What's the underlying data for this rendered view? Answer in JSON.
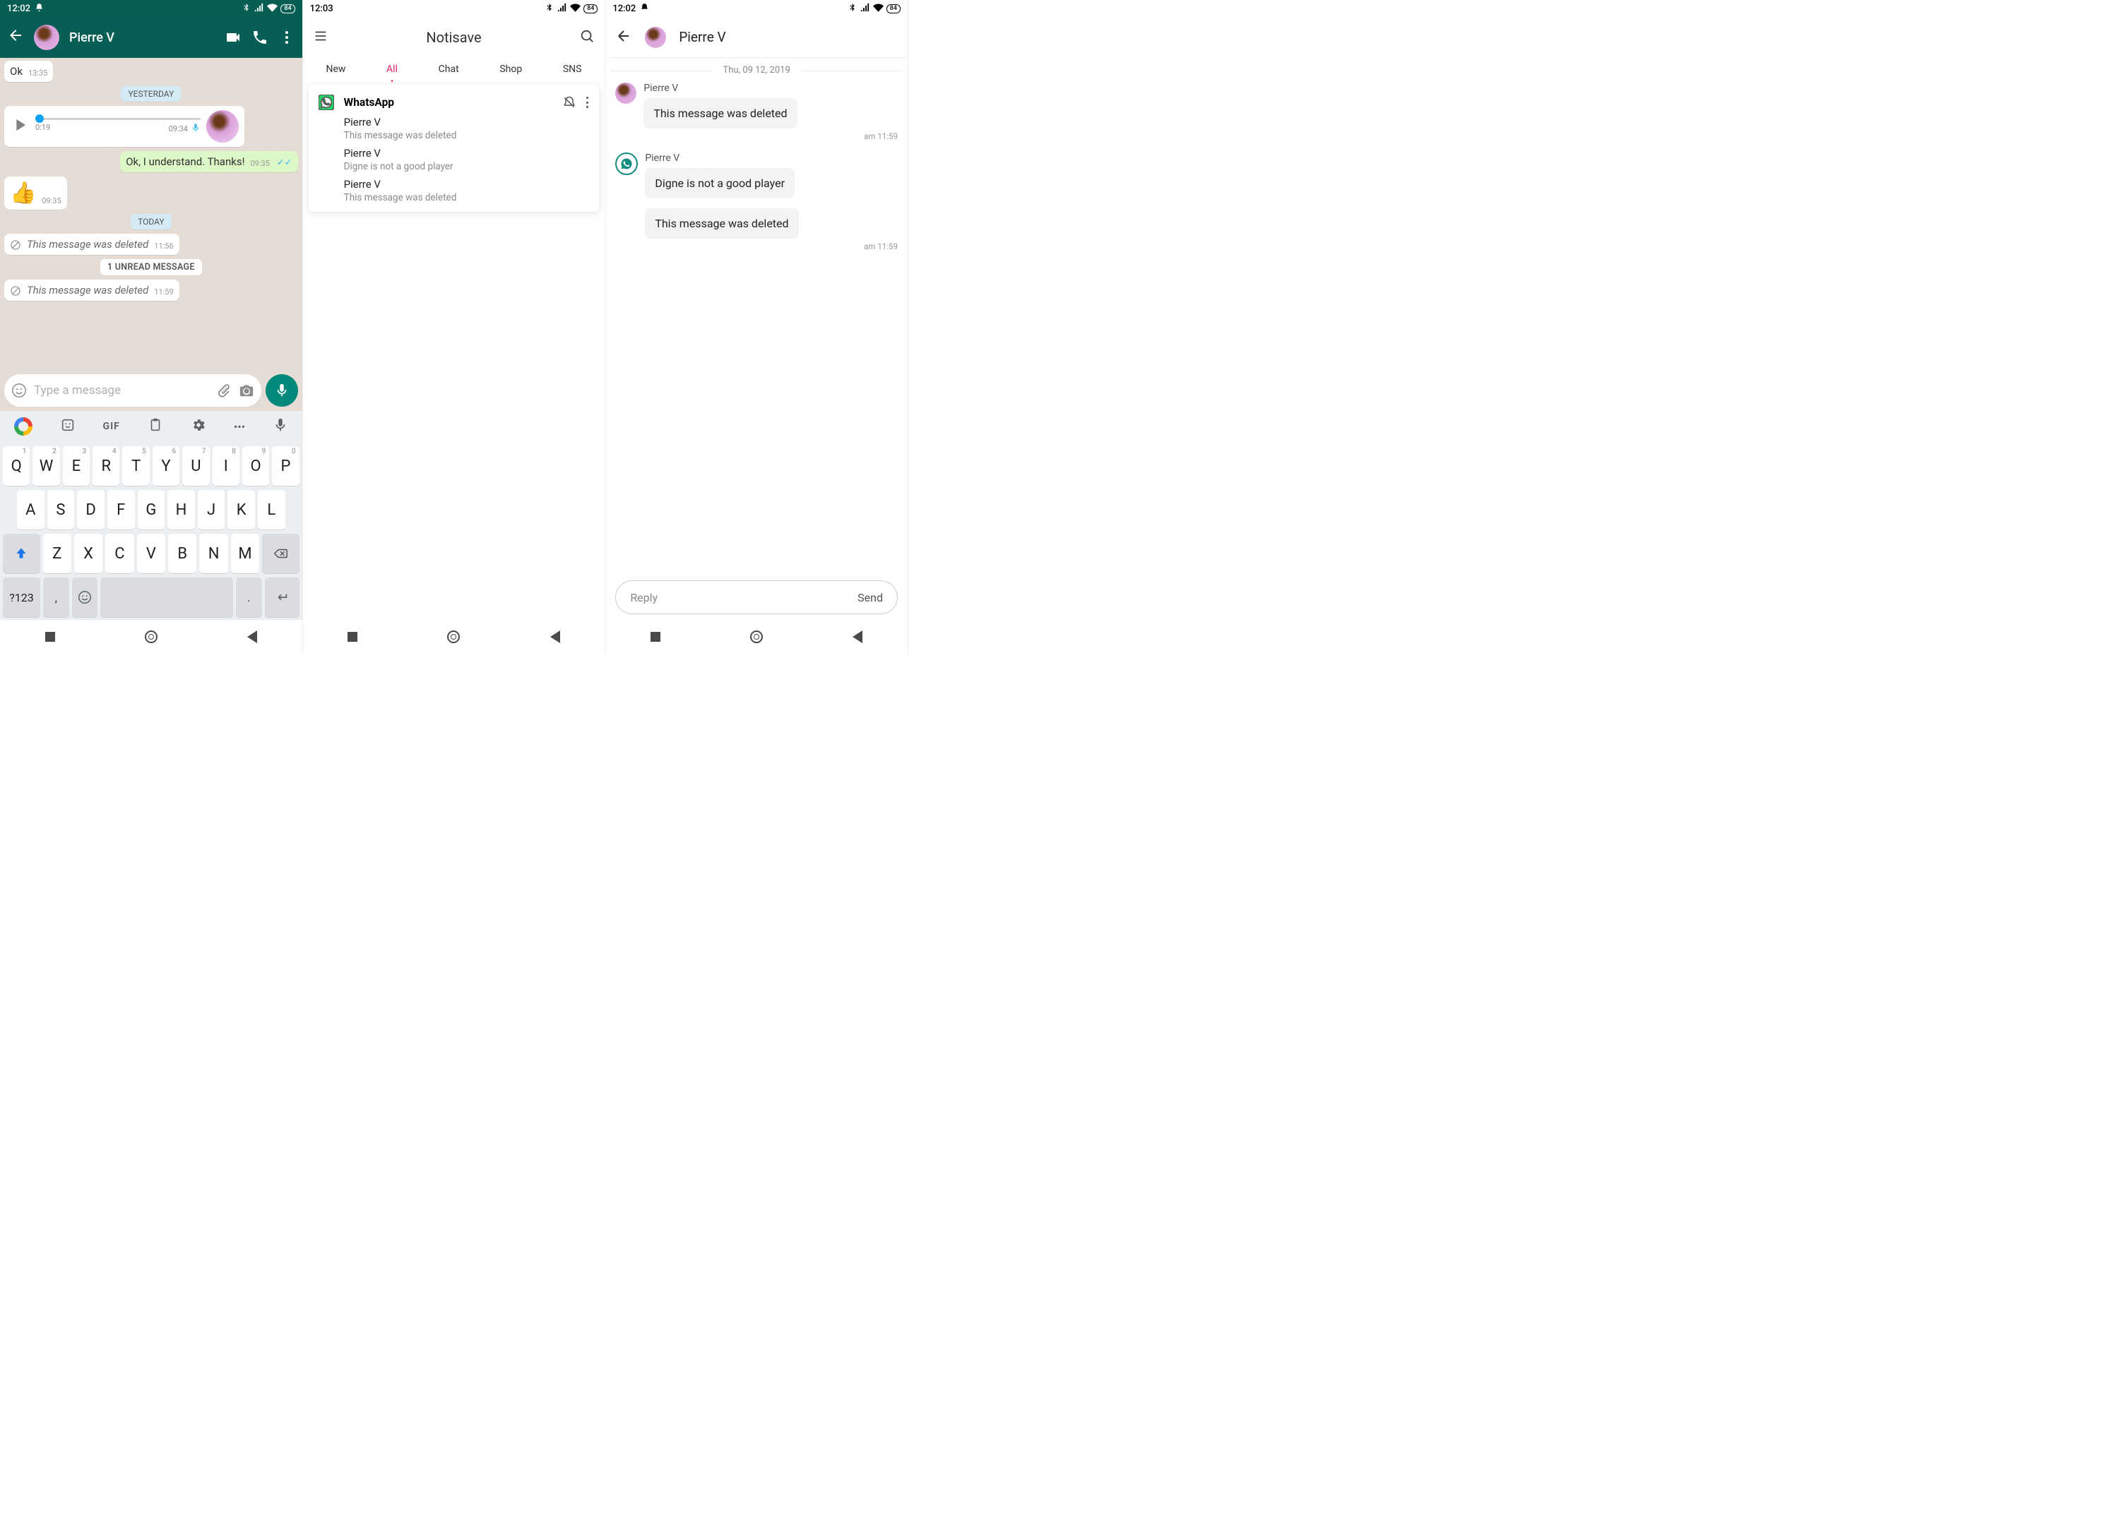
{
  "status": {
    "time1": "12:02",
    "time2": "12:03",
    "time3": "12:02",
    "battery": "84"
  },
  "wa": {
    "contact": "Pierre V",
    "first_msg": "Ok",
    "first_time": "13:35",
    "pill_yesterday": "YESTERDAY",
    "audio_dur": "0:19",
    "audio_time": "09:34",
    "out_msg": "Ok, I understand. Thanks!",
    "out_time": "09:35",
    "thumb_time": "09:35",
    "pill_today": "TODAY",
    "deleted_label": "This message was deleted",
    "del_time1": "11:56",
    "unread": "1 UNREAD MESSAGE",
    "del_time2": "11:59",
    "placeholder": "Type a message"
  },
  "kb": {
    "row1": [
      "Q",
      "W",
      "E",
      "R",
      "T",
      "Y",
      "U",
      "I",
      "O",
      "P"
    ],
    "sup1": [
      "1",
      "2",
      "3",
      "4",
      "5",
      "6",
      "7",
      "8",
      "9",
      "0"
    ],
    "row2": [
      "A",
      "S",
      "D",
      "F",
      "G",
      "H",
      "J",
      "K",
      "L"
    ],
    "row3": [
      "Z",
      "X",
      "C",
      "V",
      "B",
      "N",
      "M"
    ],
    "fn123": "?123",
    "comma": ",",
    "period": ".",
    "gif": "GIF",
    "dots": "•••"
  },
  "ns": {
    "title": "Notisave",
    "tabs": {
      "new": "New",
      "all": "All",
      "chat": "Chat",
      "shop": "Shop",
      "sns": "SNS"
    },
    "app": "WhatsApp",
    "items": [
      {
        "sender": "Pierre V",
        "body": "This message was deleted"
      },
      {
        "sender": "Pierre V",
        "body": "Digne is not a good player"
      },
      {
        "sender": "Pierre V",
        "body": "This message was deleted"
      }
    ]
  },
  "nd": {
    "contact": "Pierre V",
    "date": "Thu, 09 12, 2019",
    "msgs": [
      {
        "sender": "Pierre V",
        "body": "This message was deleted",
        "time": "am 11:59"
      },
      {
        "sender": "Pierre V",
        "body": "Digne is not a good player",
        "time": ""
      },
      {
        "sender": "",
        "body": "This message was deleted",
        "time": "am 11:59"
      }
    ],
    "reply_ph": "Reply",
    "send": "Send"
  }
}
